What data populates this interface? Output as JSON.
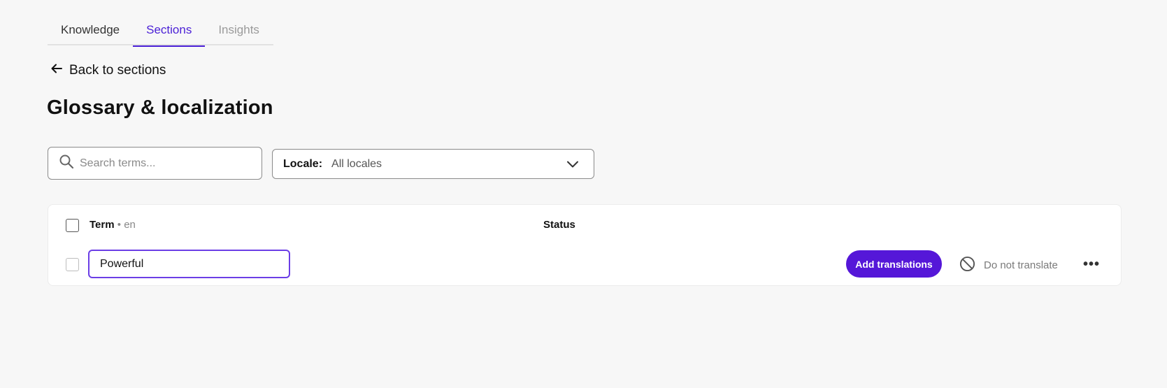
{
  "tabs": [
    {
      "label": "Knowledge"
    },
    {
      "label": "Sections"
    },
    {
      "label": "Insights"
    }
  ],
  "back_link": {
    "label": "Back to sections"
  },
  "page_title": "Glossary & localization",
  "search": {
    "placeholder": "Search terms...",
    "value": ""
  },
  "locale": {
    "label": "Locale:",
    "value": "All locales"
  },
  "table": {
    "header": {
      "term": "Term",
      "separator": "•",
      "language": "en",
      "status": "Status"
    },
    "rows": [
      {
        "term": "Powerful",
        "add_button": "Add translations",
        "do_not_translate": "Do not translate",
        "more": "•••"
      }
    ]
  },
  "colors": {
    "accent": "#5517d8",
    "active_tab": "#4a1fd6",
    "background": "#f7f7f7"
  },
  "icons": [
    "arrow-left-icon",
    "search-icon",
    "chevron-down-icon",
    "prohibited-icon",
    "more-horizontal-icon"
  ]
}
